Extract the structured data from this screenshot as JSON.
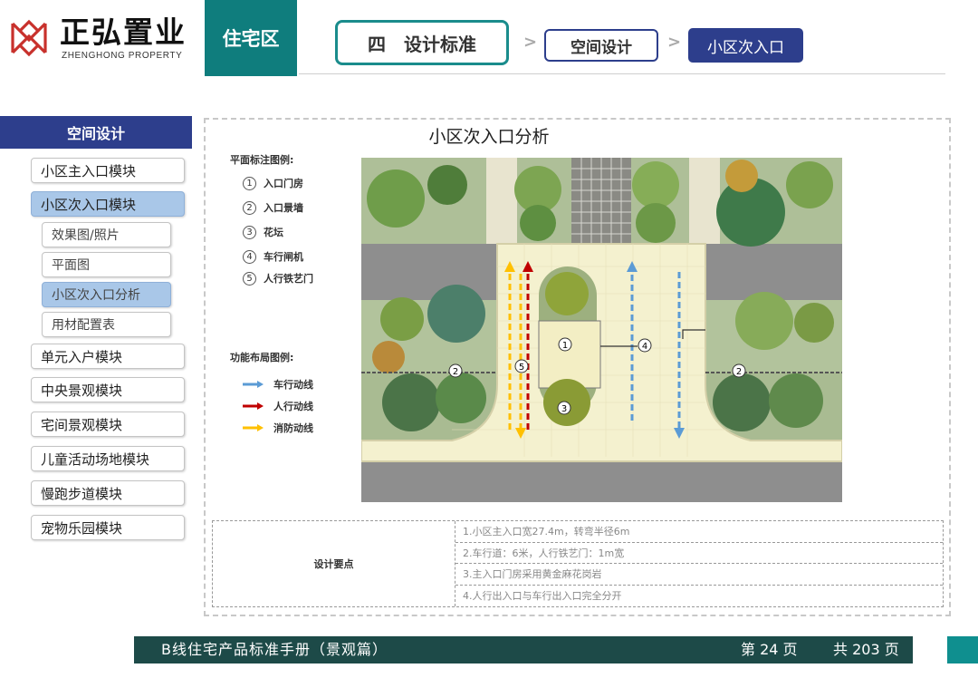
{
  "header": {
    "logo_cn": "正弘置业",
    "logo_en": "ZHENGHONG PROPERTY",
    "section": "住宅区",
    "breadcrumb": {
      "step1": "四　设计标准",
      "step2": "空间设计",
      "step3": "小区次入口",
      "separator": ">"
    }
  },
  "sidebar": {
    "header": "空间设计",
    "items": [
      {
        "label": "小区主入口模块"
      },
      {
        "label": "小区次入口模块"
      },
      {
        "label": "效果图/照片"
      },
      {
        "label": "平面图"
      },
      {
        "label": "小区次入口分析"
      },
      {
        "label": "用材配置表"
      },
      {
        "label": "单元入户模块"
      },
      {
        "label": "中央景观模块"
      },
      {
        "label": "宅间景观模块"
      },
      {
        "label": "儿童活动场地模块"
      },
      {
        "label": "慢跑步道模块"
      },
      {
        "label": "宠物乐园模块"
      }
    ]
  },
  "main": {
    "title": "小区次入口分析",
    "plan_legend_title": "平面标注图例:",
    "plan_legend": [
      {
        "num": "1",
        "label": "入口门房"
      },
      {
        "num": "2",
        "label": "入口景墙"
      },
      {
        "num": "3",
        "label": "花坛"
      },
      {
        "num": "4",
        "label": "车行闸机"
      },
      {
        "num": "5",
        "label": "人行铁艺门"
      }
    ],
    "flow_legend_title": "功能布局图例:",
    "flow_legend": [
      {
        "label": "车行动线",
        "color": "#5b9bd5"
      },
      {
        "label": "人行动线",
        "color": "#c00000"
      },
      {
        "label": "消防动线",
        "color": "#ffc000"
      }
    ]
  },
  "requirements": {
    "label": "设计要点",
    "rows": [
      "1.小区主入口宽27.4m，转弯半径6m",
      "2.车行道：6米，人行铁艺门：1m宽",
      "3.主入口门房采用黄金麻花岗岩",
      "4.人行出入口与车行出入口完全分开"
    ]
  },
  "footer": {
    "title": "B线住宅产品标准手册（景观篇）",
    "page": "第 24 页",
    "total": "共 203 页"
  },
  "colors": {
    "brand_red": "#c8312c",
    "teal": "#0f7d7d",
    "navy": "#2d3e8c",
    "footer_bg": "#1d4a48"
  }
}
